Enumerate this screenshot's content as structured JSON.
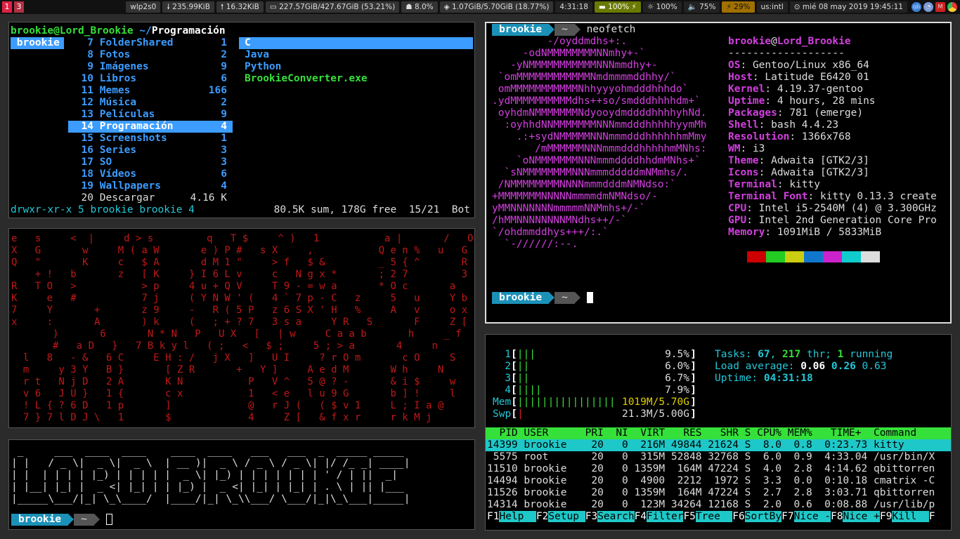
{
  "topbar": {
    "workspaces": [
      "1",
      "3"
    ],
    "blocks": [
      "wlp2s0",
      "🠗 235.99KiB",
      "🠕 16.32KiB",
      "▭ 227.57GiB/427.67GiB (53.21%)",
      "☗ 8.0%",
      "◈ 1.07GiB/5.70GiB (18.77%)",
      "4:31:18",
      "▬ 100% ⚡",
      "☼ 100%",
      "🔈 75%",
      "⚡ 29%",
      "us:intl",
      "⊙ mié 08 may 2019 19:45:11"
    ]
  },
  "ranger": {
    "header_user": "brookie@Lord_Brookie",
    "header_path": " ~/",
    "header_dir": "Programación",
    "left_item": " brookie",
    "items": [
      {
        "num": "7",
        "name": "FolderShared",
        "count": "1"
      },
      {
        "num": "8",
        "name": "Fotos",
        "count": "2"
      },
      {
        "num": "9",
        "name": "Imágenes",
        "count": "9"
      },
      {
        "num": "10",
        "name": "Libros",
        "count": "6"
      },
      {
        "num": "11",
        "name": "Memes",
        "count": "166"
      },
      {
        "num": "12",
        "name": "Música",
        "count": "2"
      },
      {
        "num": "13",
        "name": "Películas",
        "count": "9"
      },
      {
        "num": "14",
        "name": "Programación",
        "count": "4"
      },
      {
        "num": "15",
        "name": "Screenshots",
        "count": "1"
      },
      {
        "num": "16",
        "name": "Series",
        "count": "3"
      },
      {
        "num": "17",
        "name": "SO",
        "count": "3"
      },
      {
        "num": "18",
        "name": "Vídeos",
        "count": "6"
      },
      {
        "num": "19",
        "name": "Wallpapers",
        "count": "4"
      },
      {
        "num": "20",
        "name": "Descargar",
        "count": "4.16 K"
      }
    ],
    "right_items": [
      "C",
      "Java",
      "Python",
      "BrookieConverter.exe"
    ],
    "status_left": "drwxr-xr-x 5 brookie brookie 4",
    "status_right": "80.5K sum, 178G free  15/21  Bot"
  },
  "cmatrix": {
    "rows": [
      "e   s     <  |     d > s         q   T $     ^ )   1           a |       /   O",
      "X   G       w     M ( a W       e ) P #   s X     ,           Q e n %   u   G",
      "Q   \"       K     c   $ A       d M 1 \"     > f   $ &         _ 5 { ^       R",
      "    + !   b       z   [ K     } I 6 L v     c   N g x *       ; 2 7         3",
      "R   T O   >           > p     4 u + Q V     T 9 - = w a       * O c       a",
      "K     e   #           7 j     ( Y N W ' (   4 ` 7 p - C   z     5   u     Y b",
      "7     Y       +       z 9     -   R ( 5 P   z 6 S X ' H   %     A   v     o x",
      "x     :       A       ) k     (   ; + ? 7   3 s a     Y R   S       F     Z [",
      "       )       6       N * N   P   U X   [   | w     C a a b       h     _ f",
      "       #   a D   }   7 B k y l   ( ;   <   $ ;     5 ; > a       4     n",
      "  l   8   - &   6 C     E H : /   j X   ]   U I     ? r O m       c O     S",
      "  m     y 3 Y   B }       [ Z R       +   Y ]     A e d M       W h     N",
      "  r t   N j D   2 A       K N           P   V ^   5 @ ? -       & i $     w",
      "  v 6   J U }   1 {       c x           1   < e   l u 9 G       b ] !     l",
      "  ! L { ? 6 D   1 p       ]             @   r J (   ( $ v 1     L ; I a @",
      "  7 } 7 l D J \\   1       $             4     Z [   & f x r     r k M j"
    ]
  },
  "figlet": {
    "lines": [
      " _     ___  ____  ____    ____  ____   ___   ___  _  _____ _____",
      "| |   / _ \\|  _ \\|  _ \\  | __ )|  _ \\ / _ \\ / _ \\| |/ /_ _| ____|",
      "| |  | | | | |_) | | | | |  _ \\| |_) | | | | | | | ' / | ||  _|",
      "| |__| |_| |  _ <| |_| | | |_) |  _ <| |_| | |_| | . \\ | || |___",
      "|_____\\___/|_| \\_\\____/  |____/|_| \\_\\\\___/ \\___/|_|\\_\\___|_____|"
    ],
    "prompt_user": "brookie",
    "prompt_dir": "~"
  },
  "neofetch": {
    "prompt_user": "brookie",
    "prompt_dir": "~",
    "command": "neofetch",
    "logo": [
      "         -/oyddmdhs+:.",
      "     -odNMMMMMMMMNNmhy+-`",
      "   -yNMMMMMMMMMMMNNNmmdhy+-",
      " `omMMMMMMMMMMMMNmdmmmmddhhy/`",
      " omMMMMMMMMMMMNhhyyyohmdddhhhdo`",
      ".ydMMMMMMMMMMdhs++so/smdddhhhhdm+`",
      " oyhdmNMMMMMMMNdyooydmddddhhhhyhNd.",
      "  :oyhhdNNMMMMMMMNNNmmdddhhhhhyymMh",
      "    .:+sydNMMMMMNNNmmmdddhhhhhhmMmy",
      "       /mMMMMMMNNNmmmdddhhhhhmMNhs:",
      "    `oNMMMMMMMNNNmmmddddhhdmMNhs+`",
      "  `sNMMMMMMMMNNNmmmdddddmNMmhs/.",
      " /NMMMMMMMMNNNNmmmdddmNMNdso:`",
      "+MMMMMMMNNNNNmmmmdmNMNdso/-",
      "yMMNNNNNNNmmmmmNNMmhs+/-`",
      "/hMMNNNNNNNNMNdhs++/-`",
      "`/ohdmmddhys+++/:.`",
      "  `-//////:--."
    ],
    "user": "brookie",
    "host": "Lord_Brookie",
    "sep": "-------------------",
    "info": [
      {
        "k": "OS",
        "v": "Gentoo/Linux x86_64"
      },
      {
        "k": "Host",
        "v": "Latitude E6420 01"
      },
      {
        "k": "Kernel",
        "v": "4.19.37-gentoo"
      },
      {
        "k": "Uptime",
        "v": "4 hours, 28 mins"
      },
      {
        "k": "Packages",
        "v": "781 (emerge)"
      },
      {
        "k": "Shell",
        "v": "bash 4.4.23"
      },
      {
        "k": "Resolution",
        "v": "1366x768"
      },
      {
        "k": "WM",
        "v": "i3"
      },
      {
        "k": "Theme",
        "v": "Adwaita [GTK2/3]"
      },
      {
        "k": "Icons",
        "v": "Adwaita [GTK2/3]"
      },
      {
        "k": "Terminal",
        "v": "kitty"
      },
      {
        "k": "Terminal Font",
        "v": "kitty 0.13.3 create"
      },
      {
        "k": "CPU",
        "v": "Intel i5-2540M (4) @ 3.300GHz"
      },
      {
        "k": "GPU",
        "v": "Intel 2nd Generation Core Pro"
      },
      {
        "k": "Memory",
        "v": "1091MiB / 5833MiB"
      }
    ],
    "swatches": [
      "#cc0000",
      "#22cc22",
      "#cccc11",
      "#1177cc",
      "#cc22cc",
      "#11cccc",
      "#dddddd"
    ]
  },
  "htop": {
    "cpus": [
      {
        "n": "1",
        "bar": "|||",
        "pct": "9.5%"
      },
      {
        "n": "2",
        "bar": "||",
        "pct": "6.0%"
      },
      {
        "n": "3",
        "bar": "||",
        "pct": "6.7%"
      },
      {
        "n": "4",
        "bar": "||||",
        "pct": "7.9%"
      }
    ],
    "mem_label": "Mem",
    "mem_bar": "||||||||||||||||",
    "mem_val": "1019M/5.70G",
    "swp_label": "Swp",
    "swp_bar": "|",
    "swp_val": "21.3M/5.00G",
    "tasks_label": "Tasks: ",
    "tasks": "67",
    "thr": "217",
    "running": "1",
    "load_label": "Load average: ",
    "load1": "0.06",
    "load5": "0.26",
    "load15": "0.63",
    "uptime_label": "Uptime: ",
    "uptime": "04:31:18",
    "header": "  PID USER      PRI  NI  VIRT   RES   SHR S CPU% MEM%   TIME+  Command",
    "procs": [
      "14399 brookie    20   0  216M 49844 21624 S  8.0  0.8  0:23.73 kitty",
      " 5575 root       20   0  315M 52848 32768 S  6.0  0.9  4:33.04 /usr/bin/X",
      "11510 brookie    20   0 1359M  164M 47224 S  4.0  2.8  4:14.62 qbittorren",
      "14494 brookie    20   0  4900  2212  1972 S  3.3  0.0  0:10.18 cmatrix -C",
      "11526 brookie    20   0 1359M  164M 47224 S  2.7  2.8  3:03.71 qbittorren",
      "14314 brookie    20   0  123M 34264 12168 S  2.0  0.6  0:08.88 /usr/lib/p"
    ],
    "fkeys": [
      {
        "k": "F1",
        "l": "Help  "
      },
      {
        "k": "F2",
        "l": "Setup "
      },
      {
        "k": "F3",
        "l": "Search"
      },
      {
        "k": "F4",
        "l": "Filter"
      },
      {
        "k": "F5",
        "l": "Tree  "
      },
      {
        "k": "F6",
        "l": "SortBy"
      },
      {
        "k": "F7",
        "l": "Nice -"
      },
      {
        "k": "F8",
        "l": "Nice +"
      },
      {
        "k": "F9",
        "l": "Kill  "
      },
      {
        "k": "F",
        "l": ""
      }
    ]
  }
}
